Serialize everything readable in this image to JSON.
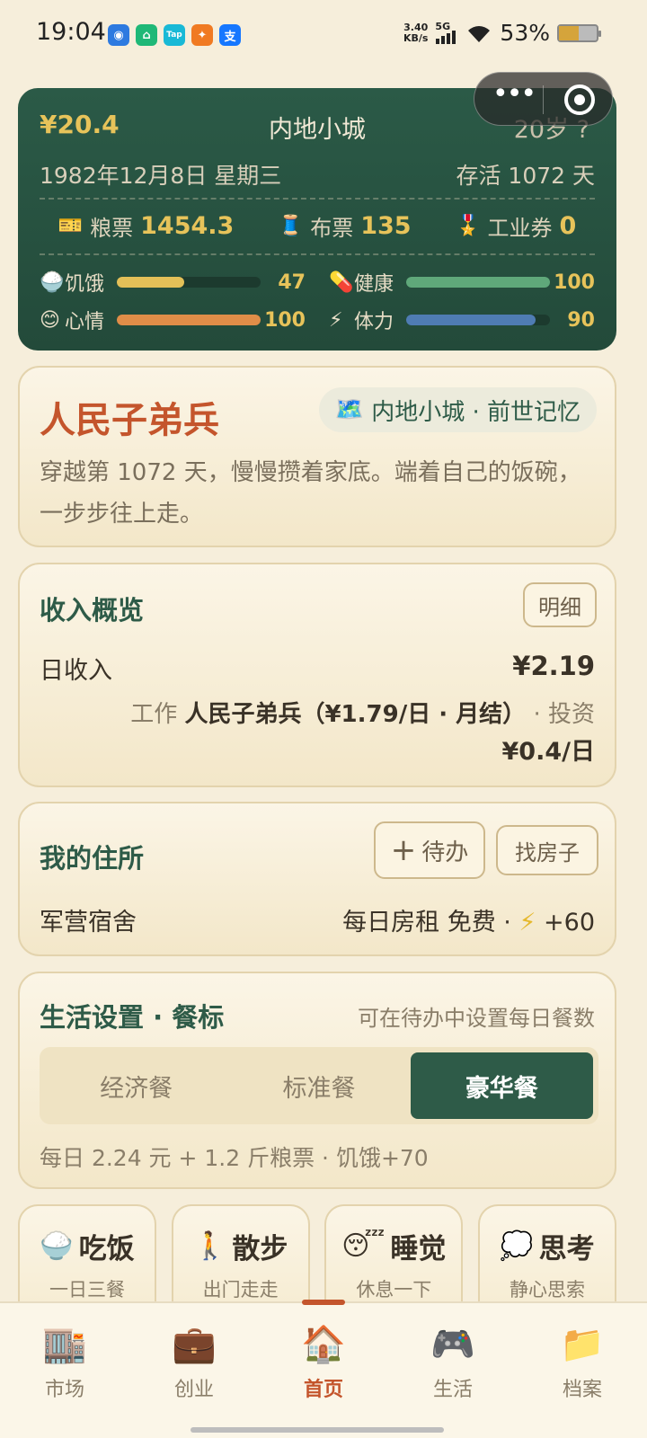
{
  "status_bar": {
    "time": "19:04",
    "net_speed": "3.40",
    "net_unit": "KB/s",
    "network": "5G",
    "battery": "53%",
    "battery_level": 0.53
  },
  "summary": {
    "money": "¥20.4",
    "city": "内地小城",
    "age": "20岁",
    "help": "?",
    "date": "1982年12月8日 星期三",
    "alive": "存活 1072 天",
    "tickets": [
      {
        "icon": "🎫",
        "label": "粮票",
        "value": "1454.3"
      },
      {
        "icon": "🧵",
        "label": "布票",
        "value": "135"
      },
      {
        "icon": "🎖️",
        "label": "工业券",
        "value": "0"
      }
    ],
    "stats": [
      {
        "icon": "🍚",
        "label": "饥饿",
        "value": "47",
        "level": 0.47,
        "color": "#e3c058"
      },
      {
        "icon": "💊",
        "label": "健康",
        "value": "100",
        "level": 1.0,
        "color": "#5fa87a"
      },
      {
        "icon": "😊",
        "label": "心情",
        "value": "100",
        "level": 1.0,
        "color": "#e08d48"
      },
      {
        "icon": "⚡",
        "label": "体力",
        "value": "90",
        "level": 0.9,
        "color": "#4f7cb3"
      }
    ]
  },
  "identity": {
    "title": "人民子弟兵",
    "tag_icon": "🗺️",
    "tag": "内地小城 · 前世记忆",
    "desc": "穿越第 1072 天，慢慢攒着家底。端着自己的饭碗，一步步往上走。"
  },
  "income": {
    "title": "收入概览",
    "detail_button": "明细",
    "daily_label": "日收入",
    "daily_value": "¥2.19",
    "work_label": "工作",
    "work_value": "人民子弟兵（¥1.79/日 · 月结）",
    "sep": "·",
    "invest_label": "投资",
    "invest_value": "¥0.4/日"
  },
  "residence": {
    "title": "我的住所",
    "todo_button": "待办",
    "find_button": "找房子",
    "name": "军营宿舍",
    "rent": "每日房租 免费 ·",
    "energy": "+60"
  },
  "meals": {
    "title": "生活设置 · 餐标",
    "hint": "可在待办中设置每日餐数",
    "options": [
      "经济餐",
      "标准餐",
      "豪华餐"
    ],
    "selected": "豪华餐",
    "summary": "每日 2.24 元 + 1.2 斤粮票 · 饥饿+70"
  },
  "actions": [
    {
      "icon": "🍚",
      "title": "吃饭",
      "sub": "一日三餐"
    },
    {
      "icon": "🚶",
      "title": "散步",
      "sub": "出门走走"
    },
    {
      "icon": "😴",
      "title": "睡觉",
      "sub": "休息一下"
    },
    {
      "icon": "💭",
      "title": "思考",
      "sub": "静心思索"
    }
  ],
  "nav": [
    {
      "icon": "🏬",
      "label": "市场"
    },
    {
      "icon": "💼",
      "label": "创业"
    },
    {
      "icon": "🏠",
      "label": "首页"
    },
    {
      "icon": "🎮",
      "label": "生活"
    },
    {
      "icon": "📁",
      "label": "档案"
    }
  ]
}
